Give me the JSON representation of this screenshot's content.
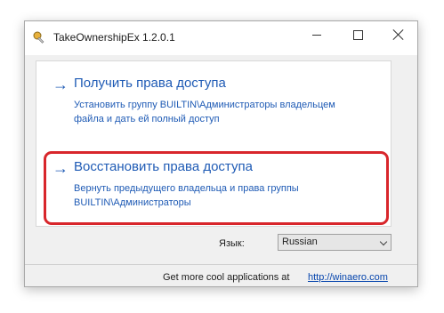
{
  "window": {
    "title": "TakeOwnershipEx 1.2.0.1",
    "icon": "key-pin-app-icon"
  },
  "options": [
    {
      "arrow": "→",
      "heading": "Получить права доступа",
      "description": "Установить группу BUILTIN\\Администраторы владельцем файла и дать ей полный доступ"
    },
    {
      "arrow": "→",
      "heading": "Восстановить права доступа",
      "description": "Вернуть предыдущего владельца и права группы BUILTIN\\Администраторы",
      "highlighted": true
    }
  ],
  "language": {
    "label": "Язык:",
    "selected": "Russian"
  },
  "footer": {
    "text": "Get more cool applications at",
    "link": "http://winaero.com"
  },
  "colors": {
    "link_blue": "#1f5bb5",
    "highlight_red": "#d8262b"
  }
}
